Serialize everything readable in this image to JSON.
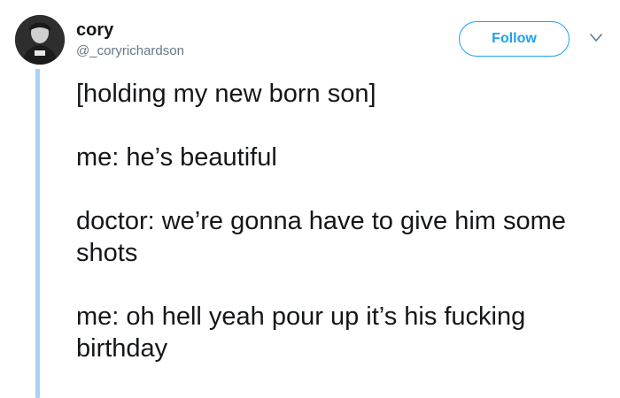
{
  "tweet": {
    "display_name": "cory",
    "handle": "@_coryrichardson",
    "follow_label": "Follow",
    "avatar_icon": "user-avatar",
    "menu_icon": "chevron-down-icon",
    "paragraphs": [
      "[holding my new born son]",
      "me: he’s beautiful",
      "doctor: we’re gonna have to give him some shots",
      "me: oh hell yeah pour up it’s his fucking birthday"
    ]
  },
  "colors": {
    "accent": "#1da1f2",
    "thread_line": "#a7d3f6",
    "handle": "#657786",
    "text": "#14171a"
  }
}
